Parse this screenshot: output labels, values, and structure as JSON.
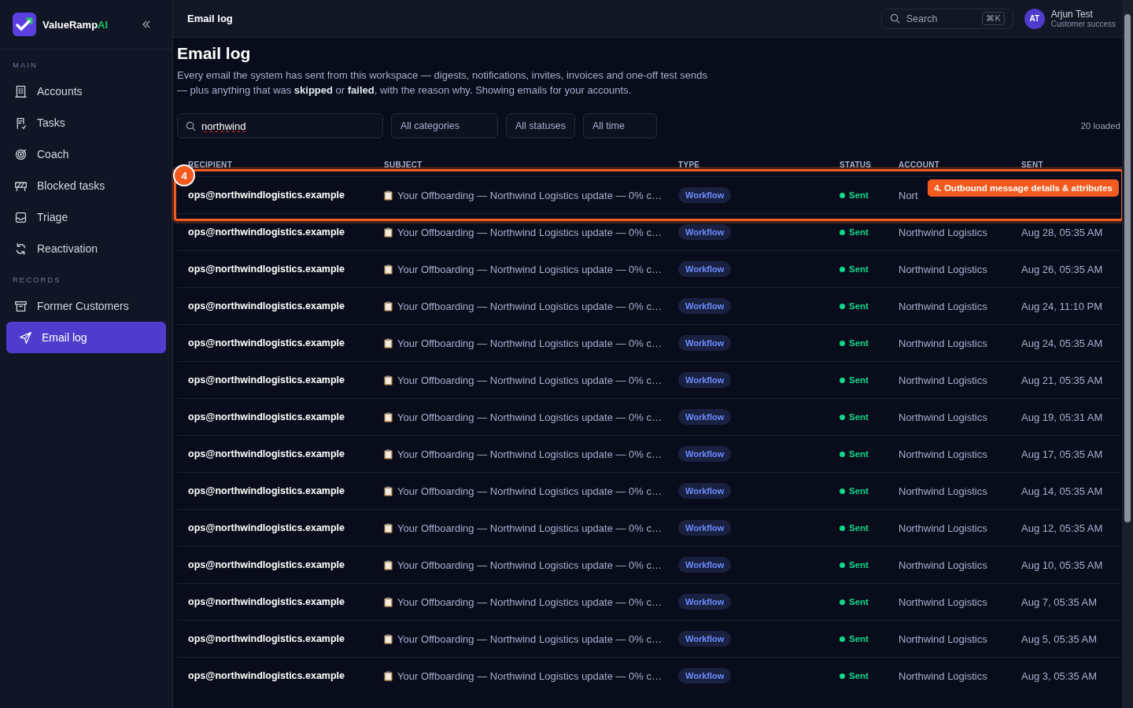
{
  "sidebar": {
    "brand": {
      "name": "ValueRamp",
      "accent": "AI"
    },
    "sections": [
      {
        "label": "MAIN",
        "items": [
          {
            "label": "Accounts",
            "selected": false
          },
          {
            "label": "Tasks",
            "selected": false
          },
          {
            "label": "Coach",
            "selected": false
          },
          {
            "label": "Blocked tasks",
            "selected": false
          },
          {
            "label": "Triage",
            "selected": false
          },
          {
            "label": "Reactivation",
            "selected": false
          }
        ]
      },
      {
        "label": "RECORDS",
        "items": [
          {
            "label": "Former Customers",
            "selected": false
          },
          {
            "label": "Email log",
            "selected": true
          }
        ]
      }
    ]
  },
  "topbar": {
    "title": "Email log",
    "search": {
      "placeholder": "Search",
      "shortcut": "⌘K"
    },
    "user": {
      "initials": "AT",
      "name": "Arjun Test",
      "role": "Customer success"
    }
  },
  "page": {
    "title": "Email log",
    "description": "Every email the system has sent from this workspace — digests, notifications, invites, invoices and one-off test sends — plus anything that was **skipped** or **failed**, with the reason why. Showing emails for your accounts."
  },
  "filters": {
    "search": {
      "value": "northwind"
    },
    "dropdowns": [
      "All categories",
      "All statuses",
      "All time"
    ],
    "count": "20 loaded"
  },
  "table": {
    "columns": [
      "RECIPIENT",
      "SUBJECT",
      "TYPE",
      "STATUS",
      "ACCOUNT",
      "SENT"
    ],
    "rows": [
      {
        "recipient": "ops@northwindlogistics.example",
        "subject": "Your Offboarding — Northwind Logistics update — 0% c…",
        "type": "Workflow",
        "status": "Sent",
        "account": "Nort"
      },
      {
        "recipient": "ops@northwindlogistics.example",
        "subject": "Your Offboarding — Northwind Logistics update — 0% c…",
        "type": "Workflow",
        "status": "Sent",
        "account": "Northwind Logistics",
        "sent": "Aug 28, 05:35 AM"
      },
      {
        "recipient": "ops@northwindlogistics.example",
        "subject": "Your Offboarding — Northwind Logistics update — 0% c…",
        "type": "Workflow",
        "status": "Sent",
        "account": "Northwind Logistics",
        "sent": "Aug 26, 05:35 AM"
      },
      {
        "recipient": "ops@northwindlogistics.example",
        "subject": "Your Offboarding — Northwind Logistics update — 0% c…",
        "type": "Workflow",
        "status": "Sent",
        "account": "Northwind Logistics",
        "sent": "Aug 24, 11:10 PM"
      },
      {
        "recipient": "ops@northwindlogistics.example",
        "subject": "Your Offboarding — Northwind Logistics update — 0% c…",
        "type": "Workflow",
        "status": "Sent",
        "account": "Northwind Logistics",
        "sent": "Aug 24, 05:35 AM"
      },
      {
        "recipient": "ops@northwindlogistics.example",
        "subject": "Your Offboarding — Northwind Logistics update — 0% c…",
        "type": "Workflow",
        "status": "Sent",
        "account": "Northwind Logistics",
        "sent": "Aug 21, 05:35 AM"
      },
      {
        "recipient": "ops@northwindlogistics.example",
        "subject": "Your Offboarding — Northwind Logistics update — 0% c…",
        "type": "Workflow",
        "status": "Sent",
        "account": "Northwind Logistics",
        "sent": "Aug 19, 05:31 AM"
      },
      {
        "recipient": "ops@northwindlogistics.example",
        "subject": "Your Offboarding — Northwind Logistics update — 0% c…",
        "type": "Workflow",
        "status": "Sent",
        "account": "Northwind Logistics",
        "sent": "Aug 17, 05:35 AM"
      },
      {
        "recipient": "ops@northwindlogistics.example",
        "subject": "Your Offboarding — Northwind Logistics update — 0% c…",
        "type": "Workflow",
        "status": "Sent",
        "account": "Northwind Logistics",
        "sent": "Aug 14, 05:35 AM"
      },
      {
        "recipient": "ops@northwindlogistics.example",
        "subject": "Your Offboarding — Northwind Logistics update — 0% c…",
        "type": "Workflow",
        "status": "Sent",
        "account": "Northwind Logistics",
        "sent": "Aug 12, 05:35 AM"
      },
      {
        "recipient": "ops@northwindlogistics.example",
        "subject": "Your Offboarding — Northwind Logistics update — 0% c…",
        "type": "Workflow",
        "status": "Sent",
        "account": "Northwind Logistics",
        "sent": "Aug 10, 05:35 AM"
      },
      {
        "recipient": "ops@northwindlogistics.example",
        "subject": "Your Offboarding — Northwind Logistics update — 0% c…",
        "type": "Workflow",
        "status": "Sent",
        "account": "Northwind Logistics",
        "sent": "Aug 7, 05:35 AM"
      },
      {
        "recipient": "ops@northwindlogistics.example",
        "subject": "Your Offboarding — Northwind Logistics update — 0% c…",
        "type": "Workflow",
        "status": "Sent",
        "account": "Northwind Logistics",
        "sent": "Aug 5, 05:35 AM"
      },
      {
        "recipient": "ops@northwindlogistics.example",
        "subject": "Your Offboarding — Northwind Logistics update — 0% c…",
        "type": "Workflow",
        "status": "Sent",
        "account": "Northwind Logistics",
        "sent": "Aug 3, 05:35 AM"
      }
    ]
  },
  "callout": {
    "number": "4",
    "label": "4. Outbound message details & attributes"
  }
}
